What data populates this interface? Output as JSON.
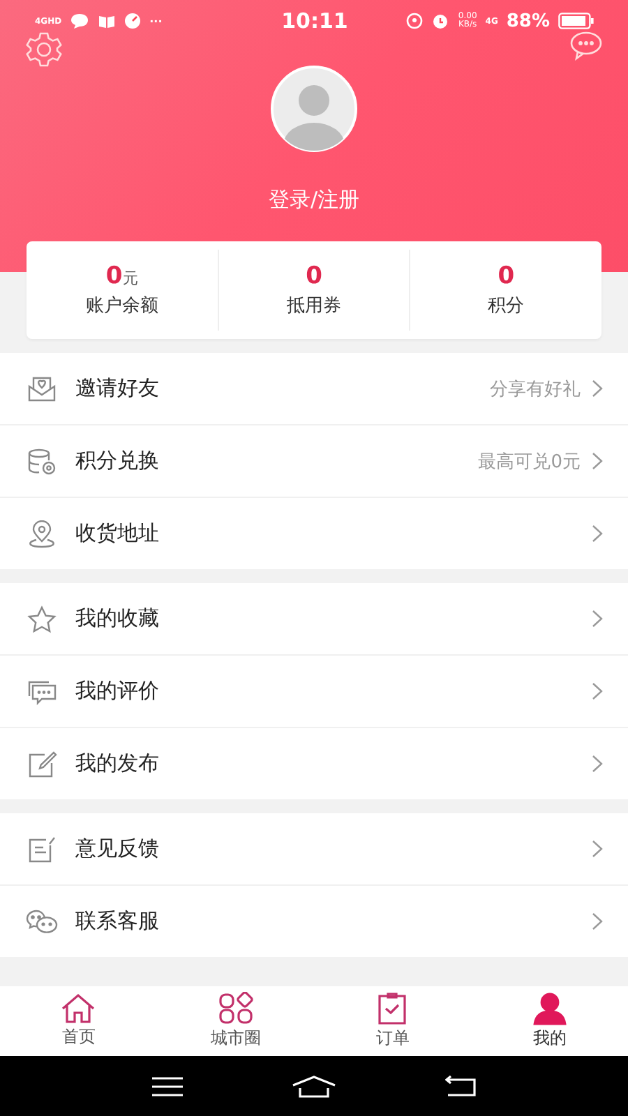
{
  "status_bar": {
    "network": "4G",
    "network_hd": "HD",
    "more": "···",
    "time": "10:11",
    "speed": "0.00",
    "speed_unit": "KB/s",
    "mobile": "4G",
    "battery": "88%"
  },
  "profile": {
    "login": "登录/注册"
  },
  "stats": [
    {
      "value": "0",
      "unit": "元",
      "label": "账户余额"
    },
    {
      "value": "0",
      "label": "抵用券"
    },
    {
      "value": "0",
      "label": "积分"
    }
  ],
  "menu_groups": [
    {
      "items": [
        {
          "label": "邀请好友",
          "hint": "分享有好礼"
        },
        {
          "label": "积分兑换",
          "hint": "最高可兑0元"
        },
        {
          "label": "收货地址"
        }
      ]
    },
    {
      "items": [
        {
          "label": "我的收藏"
        },
        {
          "label": "我的评价"
        },
        {
          "label": "我的发布"
        }
      ]
    },
    {
      "items": [
        {
          "label": "意见反馈"
        },
        {
          "label": "联系客服"
        }
      ]
    }
  ],
  "tabs": [
    {
      "label": "首页",
      "selected": false
    },
    {
      "label": "城市圈",
      "selected": false
    },
    {
      "label": "订单",
      "selected": false
    },
    {
      "label": "我的",
      "selected": true
    }
  ]
}
